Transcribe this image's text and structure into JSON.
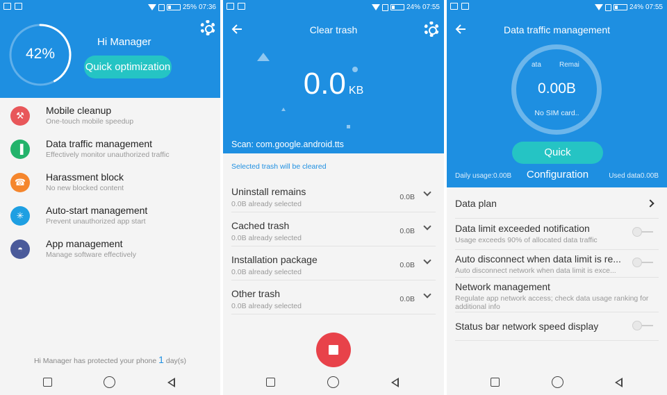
{
  "colors": {
    "primary": "#1e8fe1",
    "accent": "#25c4c4",
    "stop": "#e8424a"
  },
  "panel1": {
    "status": {
      "battery": "25%",
      "time": "07:36"
    },
    "app_title": "Hi Manager",
    "score_pct": "42%",
    "score_fraction": 0.42,
    "optimize_btn": "Quick optimization",
    "menu": [
      {
        "title": "Mobile cleanup",
        "subtitle": "One-touch mobile speedup",
        "icon": "broom-icon",
        "color": "#e8575a"
      },
      {
        "title": "Data traffic management",
        "subtitle": "Effectively monitor unauthorized traffic",
        "icon": "bars-icon",
        "color": "#23b36b"
      },
      {
        "title": "Harassment block",
        "subtitle": "No new blocked content",
        "icon": "phone-icon",
        "color": "#f5862d"
      },
      {
        "title": "Auto-start management",
        "subtitle": "Prevent unauthorized app start",
        "icon": "sparkle-icon",
        "color": "#1e9fe2"
      },
      {
        "title": "App management",
        "subtitle": "Manage software effectively",
        "icon": "android-icon",
        "color": "#4a5a9a"
      }
    ],
    "protect_prefix": "Hi Manager has protected your phone",
    "protect_days": "1",
    "protect_suffix": "day(s)"
  },
  "panel2": {
    "status": {
      "battery": "24%",
      "time": "07:55"
    },
    "title": "Clear trash",
    "size_value": "0.0",
    "size_unit": "KB",
    "scan_text": "Scan: com.google.android.tts",
    "hint": "Selected trash will be cleared",
    "rows": [
      {
        "title": "Uninstall remains",
        "subtitle": "0.0B already selected",
        "size": "0.0B"
      },
      {
        "title": "Cached trash",
        "subtitle": "0.0B already selected",
        "size": "0.0B"
      },
      {
        "title": "Installation package",
        "subtitle": "0.0B already selected",
        "size": "0.0B"
      },
      {
        "title": "Other trash",
        "subtitle": "0.0B already selected",
        "size": "0.0B"
      }
    ]
  },
  "panel3": {
    "status": {
      "battery": "24%",
      "time": "07:55"
    },
    "title": "Data traffic management",
    "ring_left_label": "ata",
    "ring_right_label": "Remai",
    "ring_value": "0.00B",
    "ring_sim": "No SIM card..",
    "config_btn": "Quick Configuration",
    "daily_usage": "Daily usage:0.00B",
    "used_data": "Used data0.00B",
    "data_plan": "Data plan",
    "settings": [
      {
        "title": "Data limit exceeded notification",
        "subtitle": "Usage exceeds 90% of allocated data traffic",
        "toggle": true
      },
      {
        "title": "Auto disconnect when data limit is re...",
        "subtitle": "Auto disconnect network when data limit is exce...",
        "toggle": true
      },
      {
        "title": "Network management",
        "subtitle": "Regulate app network access; check data usage ranking for additional info",
        "toggle": false
      },
      {
        "title": "Status bar network speed display",
        "subtitle": "",
        "toggle": true
      }
    ]
  }
}
